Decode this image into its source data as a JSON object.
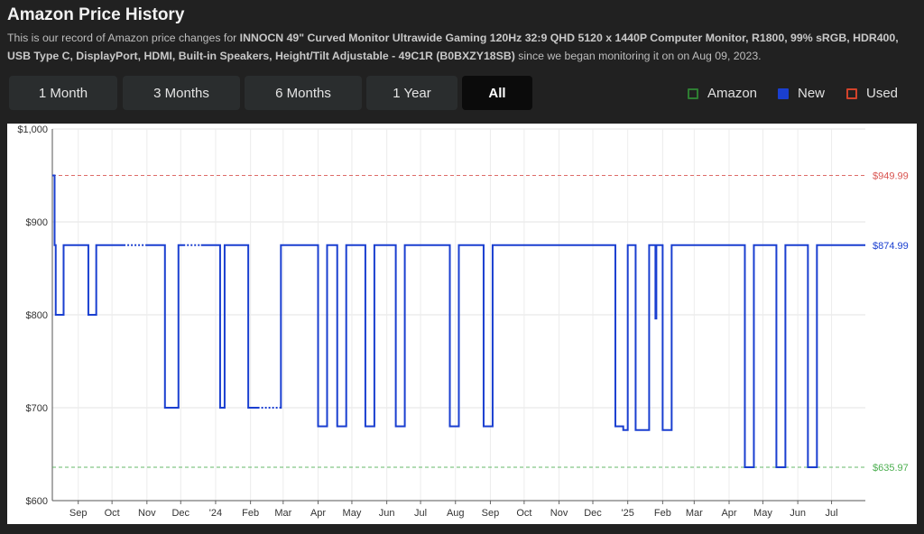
{
  "header": {
    "title": "Amazon Price History",
    "desc_prefix": "This is our record of Amazon price changes for ",
    "product": "INNOCN 49\" Curved Monitor Ultrawide Gaming 120Hz 32:9 QHD 5120 x 1440P Computer Monitor, R1800, 99% sRGB, HDR400, USB Type C, DisplayPort, HDMI, Built-in Speakers, Height/Tilt Adjustable - 49C1R (B0BXZY18SB)",
    "desc_suffix": " since we began monitoring it on on Aug 09, 2023."
  },
  "ranges": [
    {
      "label": "1 Month",
      "active": false
    },
    {
      "label": "3 Months",
      "active": false
    },
    {
      "label": "6 Months",
      "active": false
    },
    {
      "label": "1 Year",
      "active": false
    },
    {
      "label": "All",
      "active": true
    }
  ],
  "legend": [
    {
      "label": "Amazon",
      "color": "#2e7d32"
    },
    {
      "label": "New",
      "color": "#1a3fd0"
    },
    {
      "label": "Used",
      "color": "#d2432b"
    }
  ],
  "chart_data": {
    "type": "line",
    "x_start": "2023-08-09",
    "x_end": "2025-07-31",
    "ylim": [
      600,
      1000
    ],
    "yticks": [
      600,
      700,
      800,
      900,
      1000
    ],
    "ytick_labels": [
      "$600",
      "$700",
      "$800",
      "$900",
      "$1,000"
    ],
    "xticks": [
      {
        "date": "2023-09-01",
        "label": "Sep"
      },
      {
        "date": "2023-10-01",
        "label": "Oct"
      },
      {
        "date": "2023-11-01",
        "label": "Nov"
      },
      {
        "date": "2023-12-01",
        "label": "Dec"
      },
      {
        "date": "2024-01-01",
        "label": "'24"
      },
      {
        "date": "2024-02-01",
        "label": "Feb"
      },
      {
        "date": "2024-03-01",
        "label": "Mar"
      },
      {
        "date": "2024-04-01",
        "label": "Apr"
      },
      {
        "date": "2024-05-01",
        "label": "May"
      },
      {
        "date": "2024-06-01",
        "label": "Jun"
      },
      {
        "date": "2024-07-01",
        "label": "Jul"
      },
      {
        "date": "2024-08-01",
        "label": "Aug"
      },
      {
        "date": "2024-09-01",
        "label": "Sep"
      },
      {
        "date": "2024-10-01",
        "label": "Oct"
      },
      {
        "date": "2024-11-01",
        "label": "Nov"
      },
      {
        "date": "2024-12-01",
        "label": "Dec"
      },
      {
        "date": "2025-01-01",
        "label": "'25"
      },
      {
        "date": "2025-02-01",
        "label": "Feb"
      },
      {
        "date": "2025-03-01",
        "label": "Mar"
      },
      {
        "date": "2025-04-01",
        "label": "Apr"
      },
      {
        "date": "2025-05-01",
        "label": "May"
      },
      {
        "date": "2025-06-01",
        "label": "Jun"
      },
      {
        "date": "2025-07-01",
        "label": "Jul"
      }
    ],
    "grid": true,
    "reference_lines": [
      {
        "value": 949.99,
        "label": "$949.99",
        "color": "#d9534f"
      },
      {
        "value": 874.99,
        "label": "$874.99",
        "color": "#1a3fd0"
      },
      {
        "value": 635.97,
        "label": "$635.97",
        "color": "#4caf50"
      }
    ],
    "series": [
      {
        "name": "New",
        "color": "#1a3fd0",
        "step_points": [
          [
            "2023-08-09",
            949.99
          ],
          [
            "2023-08-11",
            874.99
          ],
          [
            "2023-08-12",
            800
          ],
          [
            "2023-08-19",
            874.99
          ],
          [
            "2023-09-10",
            800
          ],
          [
            "2023-09-17",
            874.99
          ],
          [
            "2023-11-17",
            700
          ],
          [
            "2023-11-29",
            874.99
          ],
          [
            "2024-01-05",
            700
          ],
          [
            "2024-01-09",
            874.99
          ],
          [
            "2024-01-30",
            700
          ],
          [
            "2024-02-28",
            874.99
          ],
          [
            "2024-04-01",
            680
          ],
          [
            "2024-04-09",
            874.99
          ],
          [
            "2024-04-18",
            680
          ],
          [
            "2024-04-26",
            874.99
          ],
          [
            "2024-05-13",
            680
          ],
          [
            "2024-05-21",
            874.99
          ],
          [
            "2024-06-09",
            680
          ],
          [
            "2024-06-17",
            874.99
          ],
          [
            "2024-07-27",
            680
          ],
          [
            "2024-08-04",
            874.99
          ],
          [
            "2024-08-26",
            680
          ],
          [
            "2024-09-03",
            874.99
          ],
          [
            "2024-12-21",
            680
          ],
          [
            "2024-12-28",
            676
          ],
          [
            "2025-01-01",
            874.99
          ],
          [
            "2025-01-08",
            676
          ],
          [
            "2025-01-20",
            874.99
          ],
          [
            "2025-02-01",
            676
          ],
          [
            "2025-02-09",
            874.99
          ],
          [
            "2025-04-15",
            635.97
          ],
          [
            "2025-04-23",
            874.99
          ],
          [
            "2025-05-13",
            635.97
          ],
          [
            "2025-05-21",
            874.99
          ],
          [
            "2025-06-10",
            635.97
          ],
          [
            "2025-06-18",
            874.99
          ],
          [
            "2025-07-31",
            874.99
          ]
        ],
        "dotted_segments": [
          [
            "2023-10-13",
            "2023-11-01"
          ],
          [
            "2023-12-05",
            "2023-12-19"
          ],
          [
            "2024-02-09",
            "2024-02-28"
          ]
        ],
        "spikes": [
          {
            "date": "2025-01-26",
            "low": 795,
            "high": 874.99
          }
        ]
      }
    ]
  }
}
